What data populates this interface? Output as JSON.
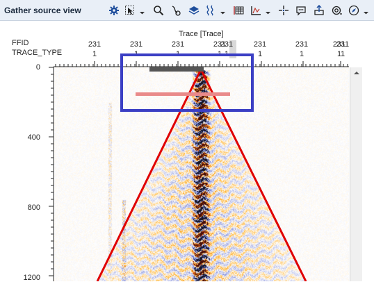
{
  "window": {
    "title": "Gather source view"
  },
  "toolbar": {
    "icons": [
      "gear-icon",
      "selection-icon",
      "zoom-icon",
      "pick-icon",
      "layers-icon",
      "wiggle-icon",
      "grid-icon",
      "axis-icon",
      "crosshair-icon",
      "comment-icon",
      "export-icon",
      "track-icon",
      "compass-icon"
    ]
  },
  "header": {
    "row1_label": "FFID",
    "row2_label": "TRACE_TYPE",
    "axis_title": "Trace [Trace]",
    "ffid_values": [
      "231",
      "231",
      "231",
      "231",
      "231",
      "231",
      "231",
      "231",
      "231"
    ],
    "trace_type_values": [
      "1",
      "1",
      "1",
      "1",
      "1",
      "1",
      "1",
      "1",
      "1"
    ]
  },
  "y_axis": {
    "ticks": [
      "0",
      "400",
      "800",
      "1200"
    ]
  },
  "colors": {
    "accent_box": "#3b3fc4",
    "mute_line": "#e00000",
    "pink_bar": "#e98a8a",
    "dark_bar": "#555555"
  }
}
